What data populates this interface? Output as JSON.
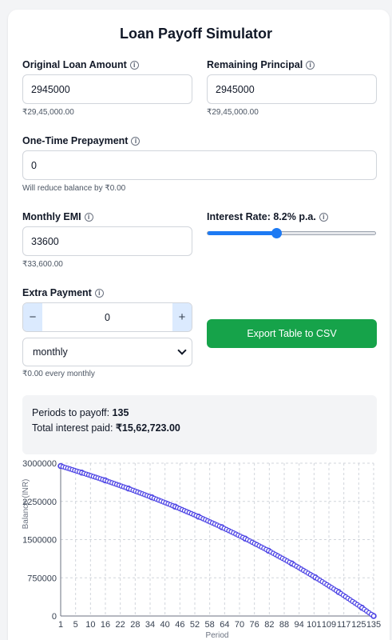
{
  "title": "Loan Payoff Simulator",
  "original_loan": {
    "label": "Original Loan Amount",
    "value": "2945000",
    "hint": "₹29,45,000.00"
  },
  "remaining_principal": {
    "label": "Remaining Principal",
    "value": "2945000",
    "hint": "₹29,45,000.00"
  },
  "prepayment": {
    "label": "One-Time Prepayment",
    "value": "0",
    "hint": "Will reduce balance by ₹0.00"
  },
  "emi": {
    "label": "Monthly EMI",
    "value": "33600",
    "hint": "₹33,600.00"
  },
  "interest": {
    "label": "Interest Rate: 8.2% p.a.",
    "rate": 8.2,
    "slider_fraction": 0.41
  },
  "extra_payment": {
    "label": "Extra Payment",
    "value": "0",
    "minus": "−",
    "plus": "+",
    "frequency": "monthly",
    "hint": "₹0.00 every monthly"
  },
  "export_button": "Export Table to CSV",
  "summary": {
    "periods_label": "Periods to payoff:",
    "periods_value": "135",
    "interest_label": "Total interest paid:",
    "interest_value": "₹15,62,723.00"
  },
  "colors": {
    "accent": "#1d7af3",
    "export": "#16a34a",
    "series": "#4f46e5"
  },
  "icons": {
    "info": "info-circle-icon",
    "select": "chevron-down-icon"
  },
  "chart_data": {
    "type": "line",
    "xlabel": "Period",
    "ylabel": "Balance (INR)",
    "ylim": [
      0,
      3000000
    ],
    "yticks": [
      "3000000",
      "2250000",
      "1500000",
      "750000",
      "0"
    ],
    "xticks": [
      "1",
      "5",
      "10",
      "16",
      "22",
      "28",
      "34",
      "40",
      "46",
      "52",
      "58",
      "64",
      "70",
      "76",
      "82",
      "88",
      "94",
      "101",
      "109",
      "117",
      "125",
      "135"
    ],
    "x_range": [
      1,
      135
    ],
    "grid": true,
    "series": [
      {
        "x": [
          1,
          10,
          20,
          30,
          40,
          50,
          60,
          70,
          80,
          90,
          100,
          110,
          120,
          130,
          135
        ],
        "values": [
          2945000,
          2815000,
          2664000,
          2503000,
          2330000,
          2147000,
          1951000,
          1743000,
          1520000,
          1282000,
          1030000,
          760000,
          471000,
          162000,
          0
        ]
      }
    ]
  }
}
